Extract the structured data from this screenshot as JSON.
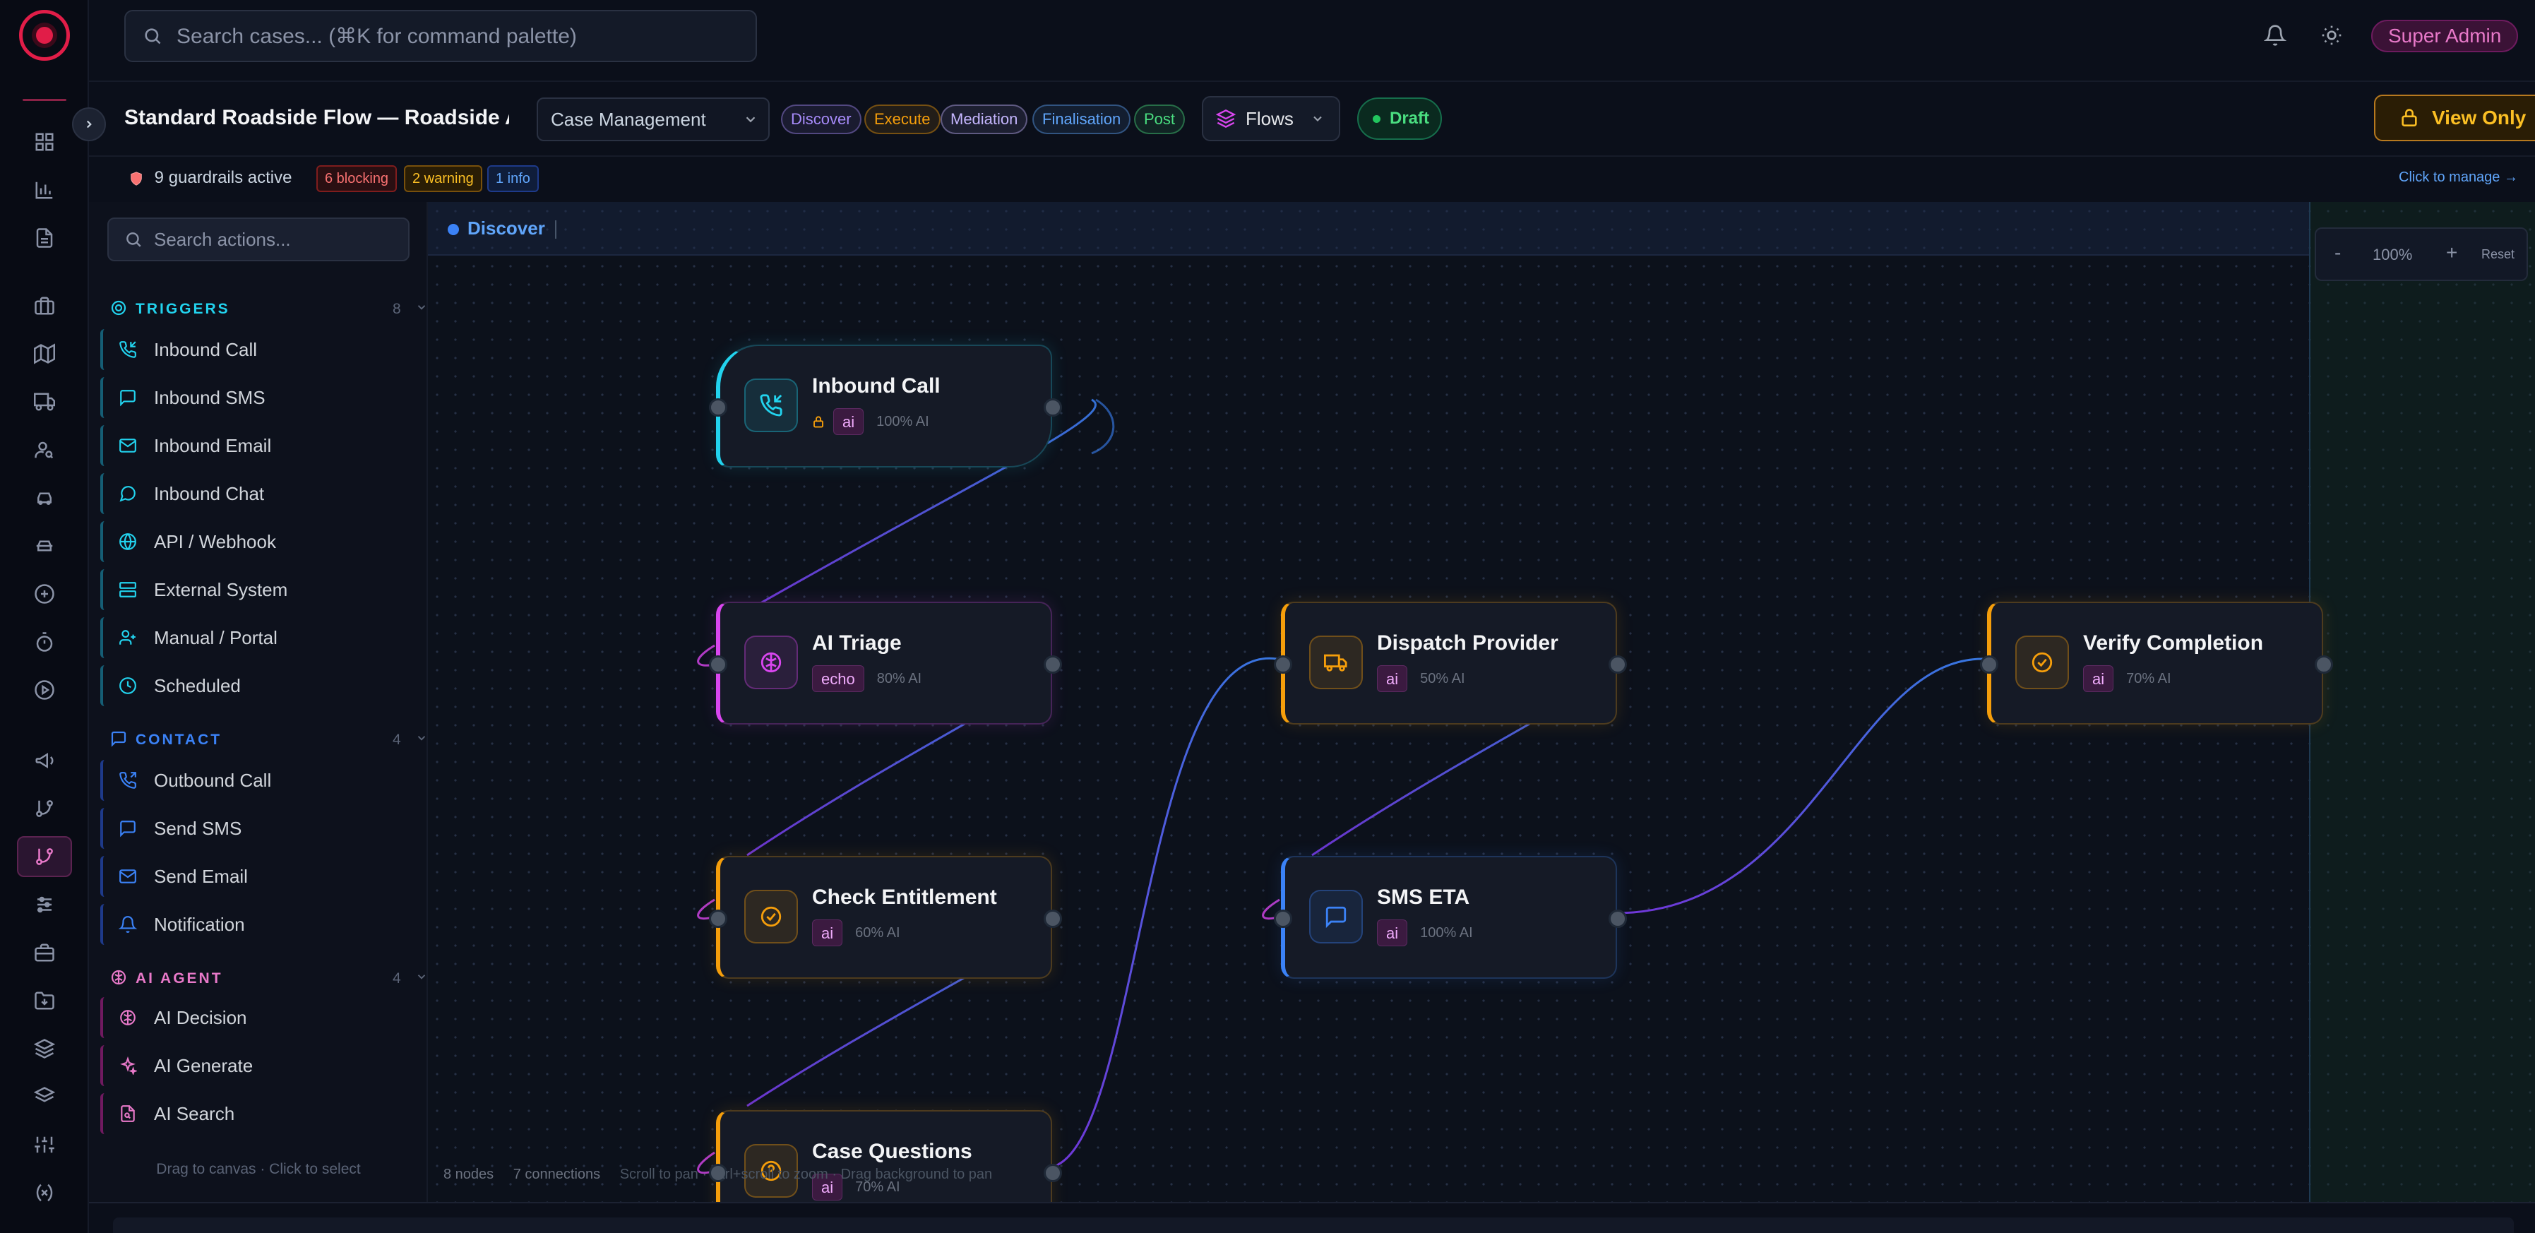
{
  "header": {
    "search_placeholder": "Search cases... (⌘K for command palette)",
    "user_badge": "Super Admin"
  },
  "flowbar": {
    "title": "Standard Roadside Flow — Roadside Ass",
    "category_select": "Case Management",
    "phases": [
      {
        "label": "Discover",
        "color": "#a78bfa"
      },
      {
        "label": "Execute",
        "color": "#f59e0b"
      },
      {
        "label": "Mediation",
        "color": "#c4b5fd"
      },
      {
        "label": "Finalisation",
        "color": "#60a5fa"
      },
      {
        "label": "Post",
        "color": "#4ade80"
      }
    ],
    "flows_button": "Flows",
    "status_badge": "Draft",
    "view_only_button": "View Only"
  },
  "guardrails": {
    "summary": "9 guardrails active",
    "blocking": "6 blocking",
    "warning": "2 warning",
    "info": "1 info",
    "manage_link": "Click to manage →"
  },
  "palette": {
    "search_placeholder": "Search actions...",
    "sections": [
      {
        "title": "TRIGGERS",
        "count": "8",
        "color": "#22d3ee",
        "icon": "target-icon",
        "items": [
          {
            "label": "Inbound Call",
            "icon": "phone-incoming-icon"
          },
          {
            "label": "Inbound SMS",
            "icon": "message-square-icon"
          },
          {
            "label": "Inbound Email",
            "icon": "mail-icon"
          },
          {
            "label": "Inbound Chat",
            "icon": "message-circle-icon"
          },
          {
            "label": "API / Webhook",
            "icon": "globe-icon"
          },
          {
            "label": "External System",
            "icon": "server-icon"
          },
          {
            "label": "Manual / Portal",
            "icon": "user-plus-icon"
          },
          {
            "label": "Scheduled",
            "icon": "clock-icon"
          }
        ]
      },
      {
        "title": "CONTACT",
        "count": "4",
        "color": "#3b82f6",
        "icon": "message-square-icon",
        "items": [
          {
            "label": "Outbound Call",
            "icon": "phone-outgoing-icon"
          },
          {
            "label": "Send SMS",
            "icon": "message-square-icon"
          },
          {
            "label": "Send Email",
            "icon": "mail-icon"
          },
          {
            "label": "Notification",
            "icon": "bell-icon"
          }
        ]
      },
      {
        "title": "AI AGENT",
        "count": "4",
        "color": "#e879c9",
        "icon": "brain-icon",
        "items": [
          {
            "label": "AI Decision",
            "icon": "brain-icon"
          },
          {
            "label": "AI Generate",
            "icon": "sparkles-icon"
          },
          {
            "label": "AI Search",
            "icon": "file-search-icon"
          }
        ]
      }
    ],
    "drag_hint": "Drag to canvas · Click to select"
  },
  "canvas": {
    "phase_label": "Discover",
    "zoom": {
      "minus": "-",
      "level": "100%",
      "plus": "+",
      "reset": "Reset"
    },
    "stats": {
      "nodes": "8 nodes",
      "connections": "7 connections",
      "hint": "Scroll to pan · Ctrl+scroll to zoom · Drag background to pan"
    },
    "nodes": [
      {
        "id": "inbound-call",
        "title": "Inbound Call",
        "tag": "ai",
        "ai": "100% AI",
        "color": "#22d3ee",
        "icon": "phone-incoming-icon",
        "locked": true
      },
      {
        "id": "ai-triage",
        "title": "AI Triage",
        "tag": "echo",
        "ai": "80% AI",
        "color": "#d946ef",
        "icon": "brain-icon"
      },
      {
        "id": "check-entitlement",
        "title": "Check Entitlement",
        "tag": "ai",
        "ai": "60% AI",
        "color": "#f59e0b",
        "icon": "check-circle-icon"
      },
      {
        "id": "case-questions",
        "title": "Case Questions",
        "tag": "ai",
        "ai": "70% AI",
        "color": "#f59e0b",
        "icon": "help-circle-icon"
      },
      {
        "id": "dispatch-provider",
        "title": "Dispatch Provider",
        "tag": "ai",
        "ai": "50% AI",
        "color": "#f59e0b",
        "icon": "truck-icon"
      },
      {
        "id": "sms-eta",
        "title": "SMS ETA",
        "tag": "ai",
        "ai": "100% AI",
        "color": "#3b82f6",
        "icon": "message-square-icon"
      },
      {
        "id": "verify-completion",
        "title": "Verify Completion",
        "tag": "ai",
        "ai": "70% AI",
        "color": "#f59e0b",
        "icon": "check-circle-icon"
      }
    ]
  }
}
